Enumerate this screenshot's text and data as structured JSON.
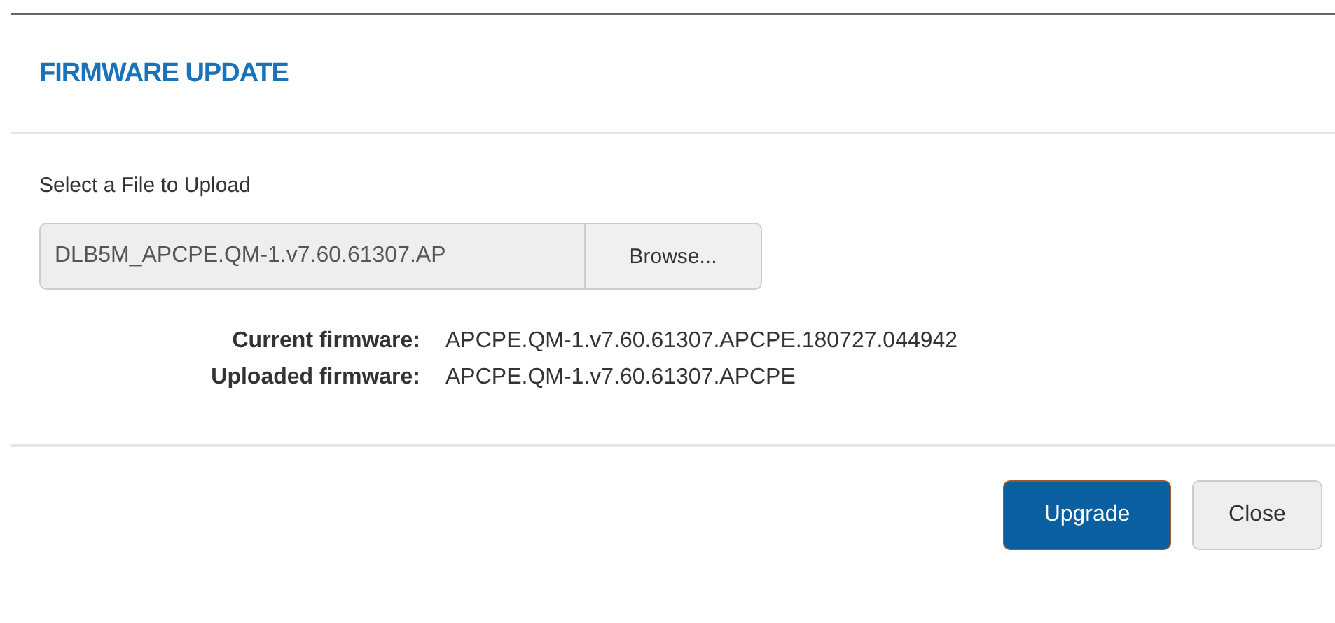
{
  "dialog": {
    "title": "FIRMWARE UPDATE"
  },
  "upload": {
    "label": "Select a File to Upload",
    "file_name": "DLB5M_APCPE.QM-1.v7.60.61307.AP",
    "browse_button": "Browse..."
  },
  "info": [
    {
      "label": "Current firmware:",
      "value": "APCPE.QM-1.v7.60.61307.APCPE.180727.044942"
    },
    {
      "label": "Uploaded firmware:",
      "value": "APCPE.QM-1.v7.60.61307.APCPE"
    }
  ],
  "buttons": [
    {
      "label": "Upgrade",
      "kind": "primary"
    },
    {
      "label": "Close",
      "kind": "default"
    }
  ]
}
